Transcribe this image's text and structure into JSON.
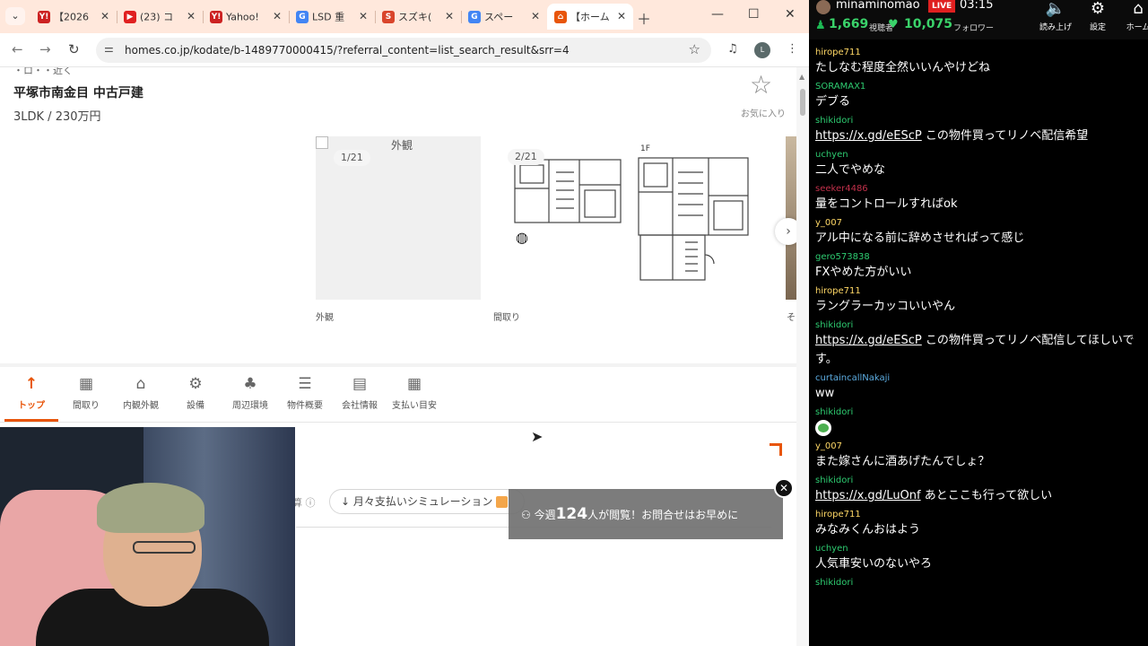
{
  "browser": {
    "tabs": [
      {
        "label": "【2026",
        "favicon": "Y!",
        "favicon_color": "#cc2222"
      },
      {
        "label": "(23) コ",
        "favicon": "▶",
        "favicon_color": "#e02020"
      },
      {
        "label": "Yahoo!",
        "favicon": "Y!",
        "favicon_color": "#cc2222"
      },
      {
        "label": "LSD 重",
        "favicon": "G",
        "favicon_color": "#4285f4"
      },
      {
        "label": "スズキ(",
        "favicon": "S",
        "favicon_color": "#d9452b"
      },
      {
        "label": "スペー",
        "favicon": "G",
        "favicon_color": "#4285f4"
      },
      {
        "label": "【ホーム",
        "favicon": "⌂",
        "favicon_color": "#e8550a"
      }
    ],
    "url": "homes.co.jp/kodate/b-1489770000415/?referral_content=list_search_result&srr=4",
    "profile_initials": "L"
  },
  "page": {
    "crumb_fragment": "・ロ・・近く",
    "title": "平塚市南金目 中古戸建",
    "subtitle": "3LDK / 230万円",
    "favorite_label": "お気に入り",
    "photos": [
      {
        "alt": "外観",
        "counter": "1/21",
        "caption": "外観"
      },
      {
        "counter": "2/21",
        "caption": "間取り",
        "floor_label": "1F"
      }
    ],
    "third_caption_fragment": "そ",
    "subnav": [
      {
        "label": "トップ",
        "icon": "arrow-up-icon",
        "glyph": "↑",
        "active": true
      },
      {
        "label": "間取り",
        "icon": "floorplan-icon",
        "glyph": "▦",
        "active": false
      },
      {
        "label": "内観外観",
        "icon": "house-icon",
        "glyph": "⌂",
        "active": false
      },
      {
        "label": "設備",
        "icon": "equipment-icon",
        "glyph": "⚙",
        "active": false
      },
      {
        "label": "周辺環境",
        "icon": "tree-icon",
        "glyph": "♣",
        "active": false
      },
      {
        "label": "物件概要",
        "icon": "document-icon",
        "glyph": "☰",
        "active": false
      },
      {
        "label": "会社情報",
        "icon": "building-icon",
        "glyph": "▤",
        "active": false
      },
      {
        "label": "支払い目安",
        "icon": "calculator-icon",
        "glyph": "▦",
        "active": false
      }
    ],
    "calc_fragment": "算",
    "sim_button": "↓ 月々支払いシミュレーション",
    "toast": {
      "prefix": "今週",
      "count": "124",
      "suffix": "人が閲覧！お問合せはお早めに"
    }
  },
  "chat": {
    "channel": "minaminomao",
    "live": "LIVE",
    "time": "03:15",
    "viewers": "1,669",
    "viewers_label": "視聴者",
    "followers": "10,075",
    "followers_label": "フォロワー",
    "buttons": [
      {
        "label": "読み上げ",
        "icon": "speaker-icon",
        "glyph": "🔈"
      },
      {
        "label": "設定",
        "icon": "gear-icon",
        "glyph": "⚙"
      },
      {
        "label": "ホーム",
        "icon": "home-icon",
        "glyph": "⌂"
      }
    ],
    "messages": [
      {
        "user": "hirope711",
        "color": "#ffd866",
        "text": "たしなむ程度全然いいんやけどね",
        "link": ""
      },
      {
        "user": "SORAMAX1",
        "color": "#2ecc71",
        "text": "デブる",
        "link": ""
      },
      {
        "user": "shikidori",
        "color": "#2ecc71",
        "link": "https://x.gd/eEScP",
        "text": " この物件買ってリノベ配信希望"
      },
      {
        "user": "uchyen",
        "color": "#2ecc71",
        "text": "二人でやめな",
        "link": ""
      },
      {
        "user": "seeker4486",
        "color": "#c0304a",
        "text": "量をコントロールすればok",
        "link": ""
      },
      {
        "user": "y_007",
        "color": "#ffd866",
        "text": "アル中になる前に辞めさせればって感じ",
        "link": ""
      },
      {
        "user": "gero573838",
        "color": "#2ecc71",
        "text": "FXやめた方がいい",
        "link": ""
      },
      {
        "user": "hirope711",
        "color": "#ffd866",
        "text": "ラングラーカッコいいやん",
        "link": ""
      },
      {
        "user": "shikidori",
        "color": "#2ecc71",
        "link": "https://x.gd/eEScP",
        "text": " この物件買ってリノベ配信してほしいです。"
      },
      {
        "user": "curtaincallNakaji",
        "color": "#5dade2",
        "text": "ww",
        "link": ""
      },
      {
        "user": "shikidori",
        "color": "#2ecc71",
        "text": "",
        "link": "",
        "emoji": "face-emoji"
      },
      {
        "user": "y_007",
        "color": "#ffd866",
        "text": "また嫁さんに酒あげたんでしょ？",
        "link": ""
      },
      {
        "user": "shikidori",
        "color": "#2ecc71",
        "link": "https://x.gd/LuOnf",
        "text": " あとここも行って欲しい"
      },
      {
        "user": "hirope711",
        "color": "#ffd866",
        "text": "みなみくんおはよう",
        "link": ""
      },
      {
        "user": "uchyen",
        "color": "#2ecc71",
        "text": "人気車安いのないやろ",
        "link": ""
      },
      {
        "user": "shikidori",
        "color": "#2ecc71",
        "text": "",
        "link": ""
      }
    ]
  }
}
